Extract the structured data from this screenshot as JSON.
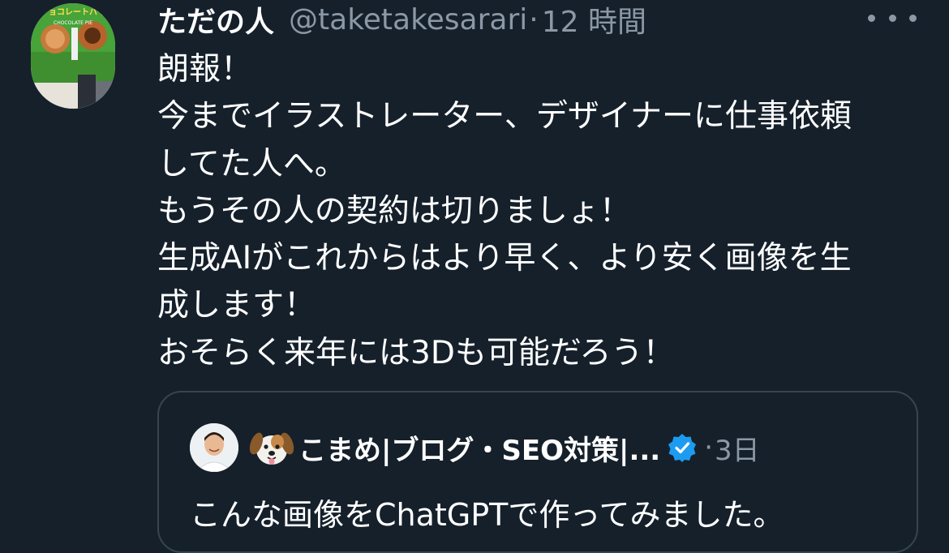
{
  "tweet": {
    "display_name": "ただの人",
    "handle": "@taketakesarari",
    "separator": "·",
    "time": "12 時間",
    "avatar_text": "チョコレートパイ",
    "avatar_sub": "CHOCOLATE PIE",
    "lines": [
      "朗報！",
      "今までイラストレーター、デザイナーに仕事依頼",
      "してた人へ。",
      "もうその人の契約は切りましょ！",
      "生成AIがこれからはより早く、より安く画像を生",
      "成します！",
      "おそらく来年には3Dも可能だろう！"
    ]
  },
  "quote": {
    "display_name": "こまめ|ブログ・SEO対策|...",
    "separator": "·",
    "time": "3日",
    "text": "こんな画像をChatGPTで作ってみました。"
  },
  "colors": {
    "background": "#15202b",
    "primary_text": "#ffffff",
    "secondary_text": "#8b98a5",
    "border": "#38444d",
    "verified": "#1d9bf0"
  }
}
